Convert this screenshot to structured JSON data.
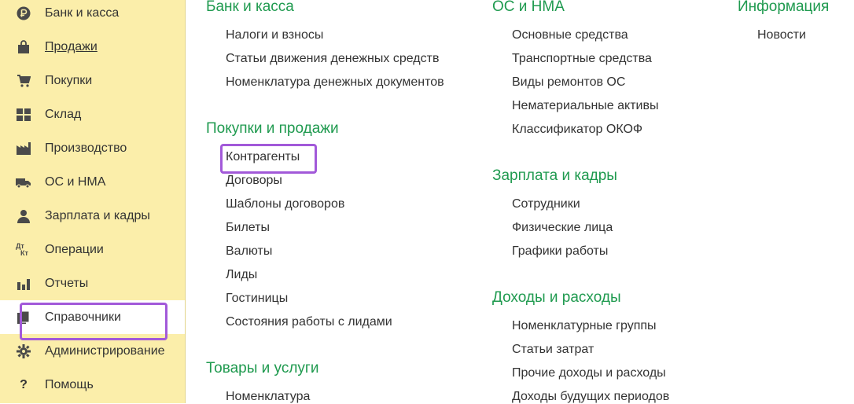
{
  "sidebar": {
    "items": [
      {
        "label": "Банк и касса",
        "icon": "ruble-icon"
      },
      {
        "label": "Продажи",
        "icon": "shopping-bag-icon"
      },
      {
        "label": "Покупки",
        "icon": "cart-icon"
      },
      {
        "label": "Склад",
        "icon": "warehouse-grid-icon"
      },
      {
        "label": "Производство",
        "icon": "factory-icon"
      },
      {
        "label": "ОС и НМА",
        "icon": "truck-icon"
      },
      {
        "label": "Зарплата и кадры",
        "icon": "person-icon"
      },
      {
        "label": "Операции",
        "icon": "dt-kt-icon",
        "icon_text_top": "Дт",
        "icon_text_bottom": "Кт"
      },
      {
        "label": "Отчеты",
        "icon": "bar-chart-icon"
      },
      {
        "label": "Справочники",
        "icon": "books-icon"
      },
      {
        "label": "Администрирование",
        "icon": "gear-icon"
      },
      {
        "label": "Помощь",
        "icon": "question-icon",
        "icon_text": "?"
      }
    ],
    "active_item": "Справочники"
  },
  "columns": {
    "col1": {
      "bank": {
        "title": "Банк и касса",
        "links": [
          "Налоги и взносы",
          "Статьи движения денежных средств",
          "Номенклатура денежных документов"
        ]
      },
      "purchases_sales": {
        "title": "Покупки и продажи",
        "links": [
          "Контрагенты",
          "Договоры",
          "Шаблоны договоров",
          "Билеты",
          "Валюты",
          "Лиды",
          "Гостиницы",
          "Состояния работы с лидами"
        ]
      },
      "goods": {
        "title": "Товары и услуги",
        "links": [
          "Номенклатура"
        ]
      }
    },
    "col2": {
      "os": {
        "title": "ОС и НМА",
        "links": [
          "Основные средства",
          "Транспортные средства",
          "Виды ремонтов ОС",
          "Нематериальные активы",
          "Классификатор ОКОФ"
        ]
      },
      "salary": {
        "title": "Зарплата и кадры",
        "links": [
          "Сотрудники",
          "Физические лица",
          "Графики работы"
        ]
      },
      "income": {
        "title": "Доходы и расходы",
        "links": [
          "Номенклатурные группы",
          "Статьи затрат",
          "Прочие доходы и расходы",
          "Доходы будущих периодов"
        ]
      }
    },
    "col3": {
      "info": {
        "title": "Информация",
        "links": [
          "Новости"
        ]
      }
    }
  },
  "colors": {
    "sidebar_bg": "#fbeeaa",
    "section_title": "#1f9a4f",
    "highlight": "#a259d9"
  }
}
